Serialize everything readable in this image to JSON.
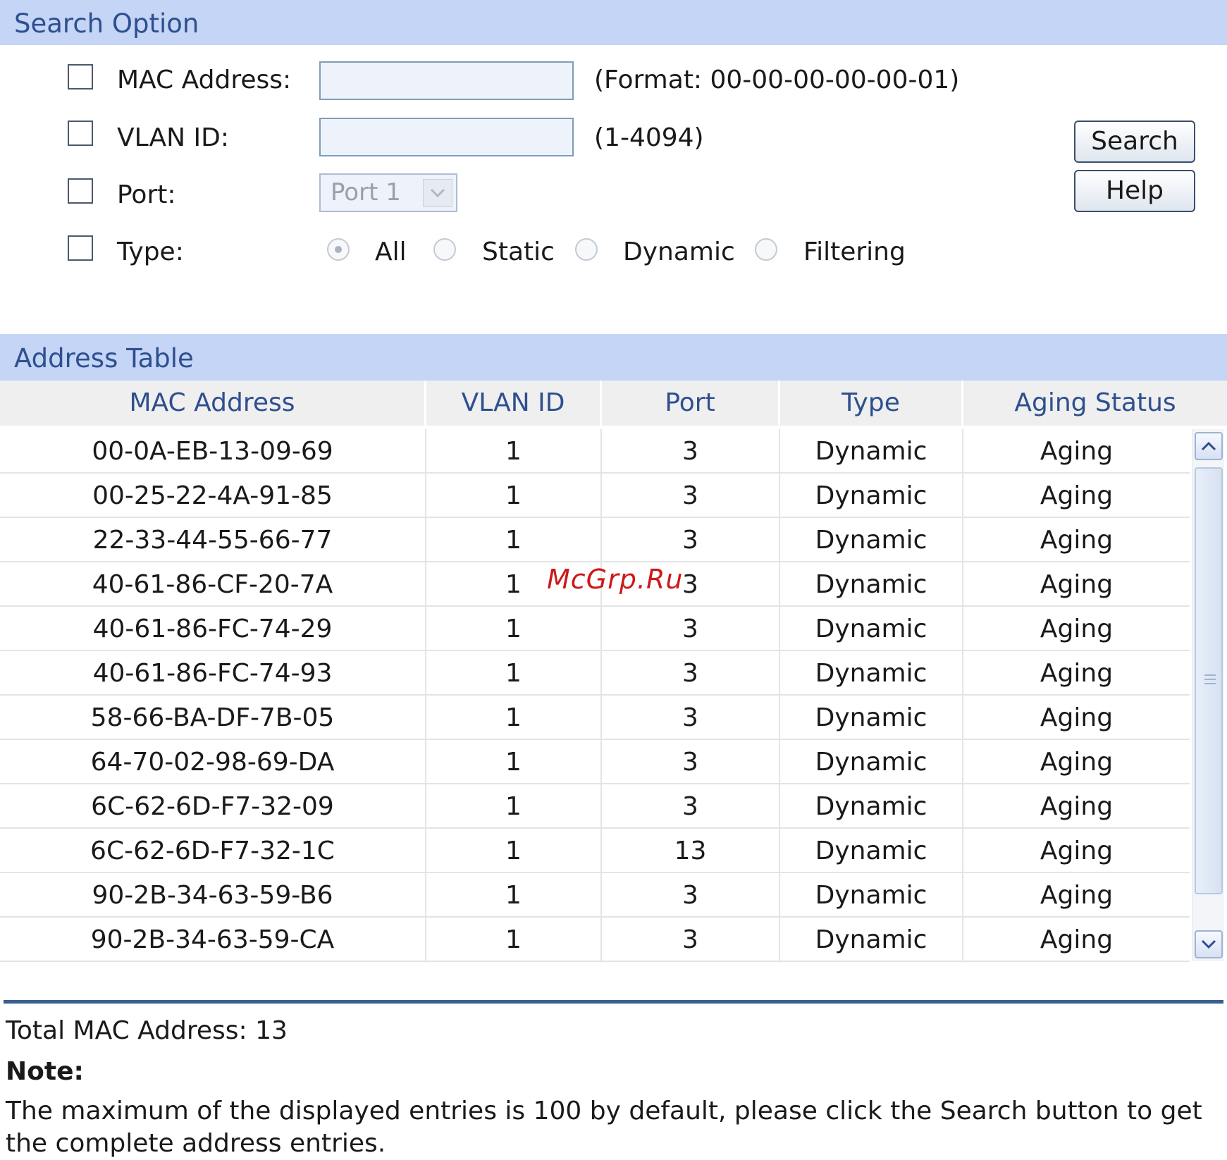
{
  "search_option": {
    "title": "Search Option",
    "mac_label": "MAC Address:",
    "mac_value": "",
    "mac_hint": "(Format: 00-00-00-00-00-01)",
    "vlan_label": "VLAN ID:",
    "vlan_value": "",
    "vlan_hint": "(1-4094)",
    "port_label": "Port:",
    "port_selected": "Port 1",
    "type_label": "Type:",
    "type_options": [
      "All",
      "Static",
      "Dynamic",
      "Filtering"
    ],
    "type_selected": "All",
    "search_button": "Search",
    "help_button": "Help"
  },
  "address_table": {
    "title": "Address Table",
    "columns": [
      "MAC Address",
      "VLAN ID",
      "Port",
      "Type",
      "Aging Status"
    ],
    "rows": [
      [
        "00-0A-EB-13-09-69",
        "1",
        "3",
        "Dynamic",
        "Aging"
      ],
      [
        "00-25-22-4A-91-85",
        "1",
        "3",
        "Dynamic",
        "Aging"
      ],
      [
        "22-33-44-55-66-77",
        "1",
        "3",
        "Dynamic",
        "Aging"
      ],
      [
        "40-61-86-CF-20-7A",
        "1",
        "3",
        "Dynamic",
        "Aging"
      ],
      [
        "40-61-86-FC-74-29",
        "1",
        "3",
        "Dynamic",
        "Aging"
      ],
      [
        "40-61-86-FC-74-93",
        "1",
        "3",
        "Dynamic",
        "Aging"
      ],
      [
        "58-66-BA-DF-7B-05",
        "1",
        "3",
        "Dynamic",
        "Aging"
      ],
      [
        "64-70-02-98-69-DA",
        "1",
        "3",
        "Dynamic",
        "Aging"
      ],
      [
        "6C-62-6D-F7-32-09",
        "1",
        "3",
        "Dynamic",
        "Aging"
      ],
      [
        "6C-62-6D-F7-32-1C",
        "1",
        "13",
        "Dynamic",
        "Aging"
      ],
      [
        "90-2B-34-63-59-B6",
        "1",
        "3",
        "Dynamic",
        "Aging"
      ],
      [
        "90-2B-34-63-59-CA",
        "1",
        "3",
        "Dynamic",
        "Aging"
      ]
    ]
  },
  "footer": {
    "total": "Total MAC Address: 13",
    "note_title": "Note:",
    "note_text": "The maximum of the displayed entries is 100 by default, please click the Search button to get the complete address entries."
  },
  "watermark": "McGrp.Ru",
  "colors": {
    "section_header_bg": "#c4d5f5",
    "header_text": "#2e4f8f",
    "divider": "#3a5f8f"
  }
}
